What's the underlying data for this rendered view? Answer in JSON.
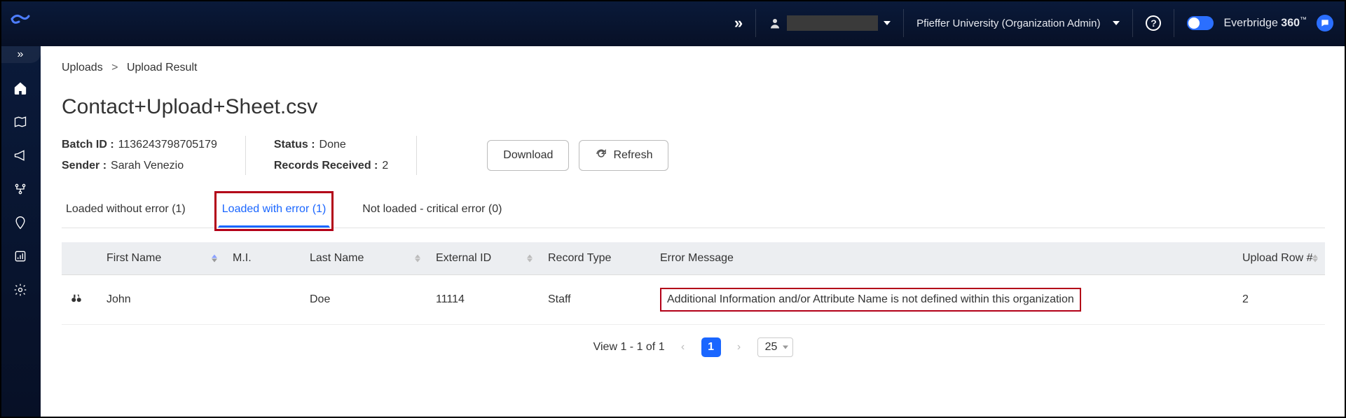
{
  "header": {
    "org_name": "Pfieffer University (Organization Admin)",
    "brand_prefix": "Everbridge",
    "brand_suffix": "360",
    "brand_tm": "™"
  },
  "breadcrumb": {
    "root": "Uploads",
    "current": "Upload Result"
  },
  "page_title": "Contact+Upload+Sheet.csv",
  "meta": {
    "batch_id_label": "Batch ID :",
    "batch_id": "1136243798705179",
    "sender_label": "Sender :",
    "sender": "Sarah Venezio",
    "status_label": "Status :",
    "status": "Done",
    "records_label": "Records Received :",
    "records": "2"
  },
  "buttons": {
    "download": "Download",
    "refresh": "Refresh"
  },
  "tabs": {
    "no_error": "Loaded without error (1)",
    "with_error": "Loaded with error (1)",
    "not_loaded": "Not loaded - critical error (0)"
  },
  "columns": {
    "first_name": "First Name",
    "mi": "M.I.",
    "last_name": "Last Name",
    "external_id": "External ID",
    "record_type": "Record Type",
    "error_message": "Error Message",
    "upload_row": "Upload Row #"
  },
  "rows": [
    {
      "first_name": "John",
      "mi": "",
      "last_name": "Doe",
      "external_id": "11114",
      "record_type": "Staff",
      "error_message": "Additional Information and/or Attribute Name is not defined within this organization",
      "upload_row": "2"
    }
  ],
  "pager": {
    "summary": "View 1 - 1 of 1",
    "page": "1",
    "page_size": "25"
  }
}
